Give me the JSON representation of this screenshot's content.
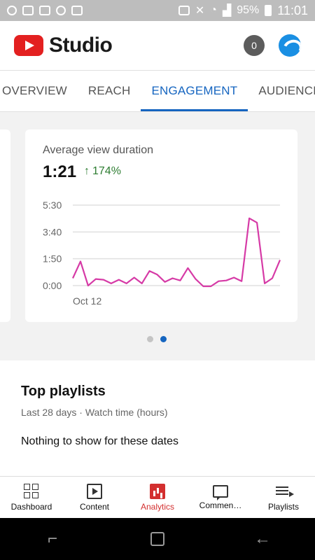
{
  "status_bar": {
    "battery": "95%",
    "time": "11:01",
    "icons": [
      "notification-icon",
      "mail-icon",
      "file-icon",
      "camera-icon",
      "activity-icon",
      "cast-icon",
      "mute-icon",
      "wifi-icon",
      "signal-icon",
      "battery-icon"
    ]
  },
  "app": {
    "title": "Studio",
    "notification_count": "0"
  },
  "tabs": [
    {
      "label": "OVERVIEW"
    },
    {
      "label": "REACH"
    },
    {
      "label": "ENGAGEMENT",
      "active": true
    },
    {
      "label": "AUDIENCE"
    }
  ],
  "card": {
    "title": "Average view duration",
    "value": "1:21",
    "change": "174%",
    "change_direction": "up",
    "change_color": "#2e7d32"
  },
  "chart_data": {
    "type": "line",
    "title": "Average view duration",
    "series": [
      {
        "color": "#d63aa6",
        "values": [
          0.5,
          1.65,
          0.0,
          0.45,
          0.4,
          0.15,
          0.4,
          0.15,
          0.55,
          0.15,
          1.0,
          0.75,
          0.25,
          0.5,
          0.35,
          1.2,
          0.45,
          -0.05,
          -0.05,
          0.3,
          0.35,
          0.55,
          0.3,
          4.6,
          4.3,
          0.15,
          0.5,
          1.75
        ]
      }
    ],
    "y_ticks": [
      "5:30",
      "3:40",
      "1:50",
      "0:00"
    ],
    "y_tick_values": [
      5.5,
      3.667,
      1.833,
      0
    ],
    "ylim": [
      0,
      5.5
    ],
    "x_tick_label": "Oct 12",
    "grid": true
  },
  "pagination": {
    "pages": 2,
    "active": 1
  },
  "playlists": {
    "title": "Top playlists",
    "subtitle": "Last 28 days · Watch time (hours)",
    "empty_message": "Nothing to show for these dates"
  },
  "bottom_nav": [
    {
      "label": "Dashboard",
      "icon": "dashboard-icon"
    },
    {
      "label": "Content",
      "icon": "content-icon"
    },
    {
      "label": "Analytics",
      "icon": "analytics-icon",
      "active": true
    },
    {
      "label": "Commen…",
      "icon": "comments-icon"
    },
    {
      "label": "Playlists",
      "icon": "playlists-icon"
    }
  ],
  "colors": {
    "brand_red": "#e32020",
    "accent_blue": "#1565c0",
    "active_nav": "#d32f2f",
    "line": "#d63aa6"
  }
}
